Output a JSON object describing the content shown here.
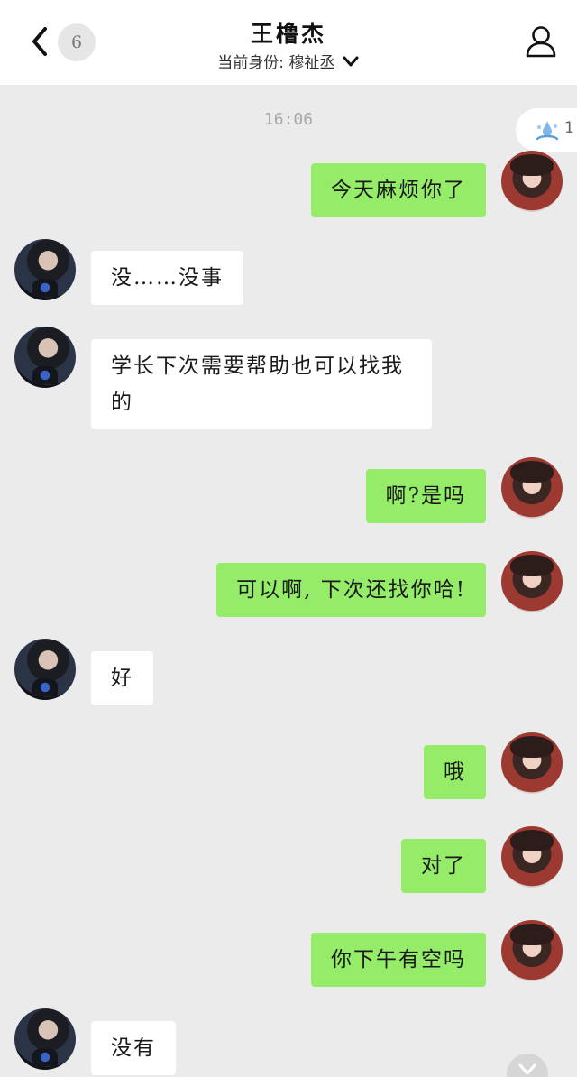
{
  "header": {
    "unread_count": "6",
    "title": "王橹杰",
    "subtitle": "当前身份: 穆祉丞"
  },
  "timestamp": "16:06",
  "floating_badge": {
    "count": "1"
  },
  "messages": [
    {
      "side": "right",
      "text": "今天麻烦你了"
    },
    {
      "side": "left",
      "text": "没……没事"
    },
    {
      "side": "left",
      "text": "学长下次需要帮助也可以找我的"
    },
    {
      "side": "right",
      "text": "啊?是吗"
    },
    {
      "side": "right",
      "text": "可以啊, 下次还找你哈!"
    },
    {
      "side": "left",
      "text": "好"
    },
    {
      "side": "right",
      "text": "哦"
    },
    {
      "side": "right",
      "text": "对了"
    },
    {
      "side": "right",
      "text": "你下午有空吗"
    },
    {
      "side": "left",
      "text": "没有"
    }
  ],
  "colors": {
    "outgoing_bubble": "#95ec69",
    "incoming_bubble": "#ffffff",
    "background": "#ebebeb"
  }
}
